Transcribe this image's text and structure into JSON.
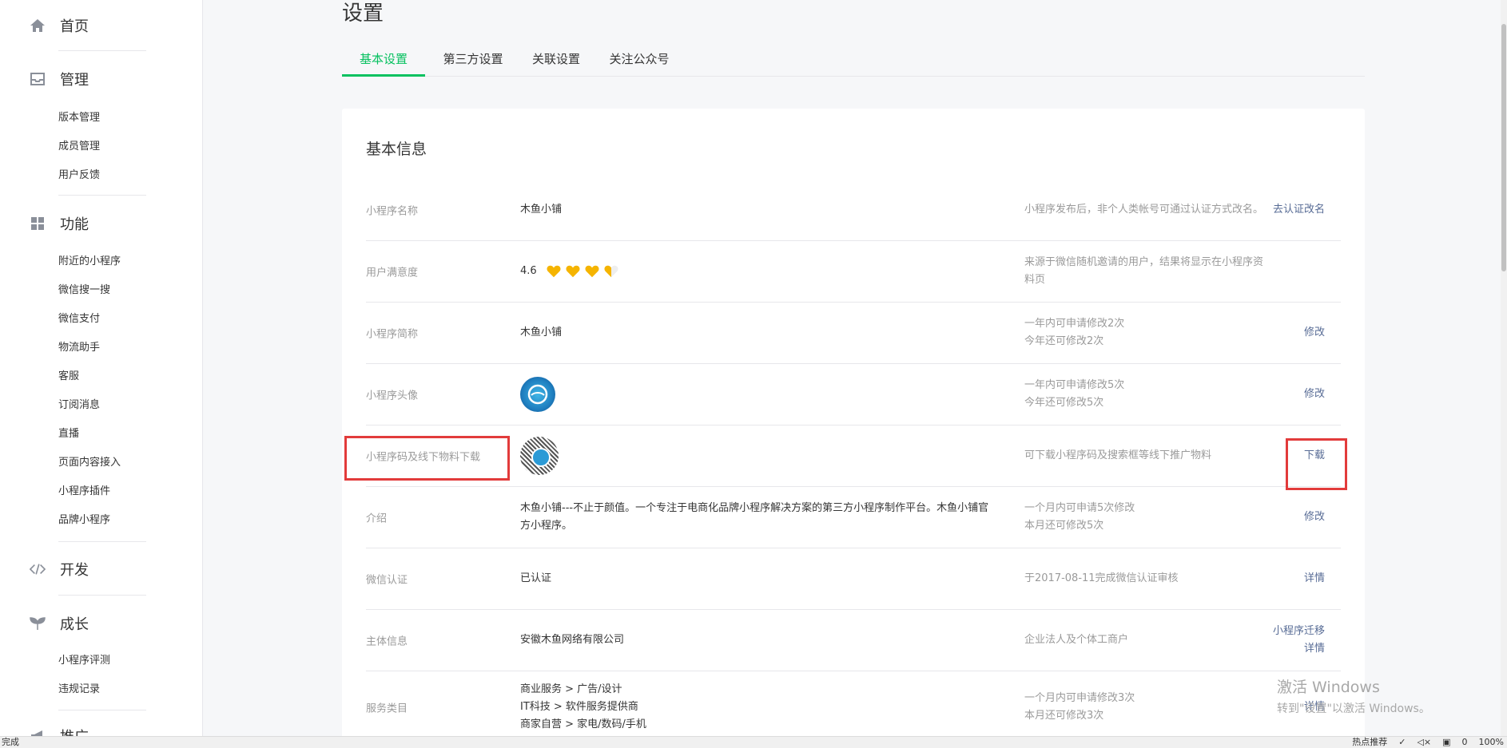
{
  "sidebar": {
    "home": {
      "label": "首页"
    },
    "manage": {
      "label": "管理",
      "items": [
        "版本管理",
        "成员管理",
        "用户反馈"
      ]
    },
    "features": {
      "label": "功能",
      "items": [
        "附近的小程序",
        "微信搜一搜",
        "微信支付",
        "物流助手",
        "客服",
        "订阅消息",
        "直播",
        "页面内容接入",
        "小程序插件",
        "品牌小程序"
      ]
    },
    "develop": {
      "label": "开发"
    },
    "growth": {
      "label": "成长",
      "items": [
        "小程序评测",
        "违规记录"
      ]
    },
    "promote": {
      "label": "推广"
    }
  },
  "page": {
    "title": "设置"
  },
  "tabs": [
    {
      "label": "基本设置",
      "active": true
    },
    {
      "label": "第三方设置",
      "active": false
    },
    {
      "label": "关联设置",
      "active": false
    },
    {
      "label": "关注公众号",
      "active": false
    }
  ],
  "card": {
    "title": "基本信息"
  },
  "rows": {
    "name": {
      "label": "小程序名称",
      "value": "木鱼小铺",
      "desc": "小程序发布后，非个人类帐号可通过认证方式改名。",
      "action": "去认证改名"
    },
    "rating": {
      "label": "用户满意度",
      "value": "4.6",
      "stars": 3.5,
      "desc": "来源于微信随机邀请的用户，结果将显示在小程序资料页"
    },
    "short": {
      "label": "小程序简称",
      "value": "木鱼小铺",
      "desc1": "一年内可申请修改2次",
      "desc2": "今年还可修改2次",
      "action": "修改"
    },
    "avatar": {
      "label": "小程序头像",
      "desc1": "一年内可申请修改5次",
      "desc2": "今年还可修改5次",
      "action": "修改"
    },
    "qrcode": {
      "label": "小程序码及线下物料下载",
      "desc": "可下载小程序码及搜索框等线下推广物料",
      "action": "下载"
    },
    "intro": {
      "label": "介绍",
      "value": "木鱼小铺---不止于颜值。一个专注于电商化品牌小程序解决方案的第三方小程序制作平台。木鱼小铺官方小程序。",
      "desc1": "一个月内可申请5次修改",
      "desc2": "本月还可修改5次",
      "action": "修改"
    },
    "verify": {
      "label": "微信认证",
      "value": "已认证",
      "desc": "于2017-08-11完成微信认证审核",
      "action": "详情"
    },
    "entity": {
      "label": "主体信息",
      "value": "安徽木鱼网络有限公司",
      "desc": "企业法人及个体工商户",
      "action1": "小程序迁移",
      "action2": "详情"
    },
    "category": {
      "label": "服务类目",
      "values": [
        "商业服务 > 广告/设计",
        "IT科技 > 软件服务提供商",
        "商家自营 > 家电/数码/手机"
      ],
      "desc1": "一个月内可申请修改3次",
      "desc2": "本月还可修改3次",
      "action": "详情"
    }
  },
  "statusbar": {
    "left": "完成",
    "items": [
      "热点推荐",
      "0",
      "100%"
    ]
  },
  "watermark": {
    "line1": "激活 Windows",
    "line2": "转到\"设置\"以激活 Windows。"
  },
  "colors": {
    "accent": "#07c160",
    "link": "#576b95",
    "highlight": "#e23b3b",
    "heart": "#f5b400"
  }
}
